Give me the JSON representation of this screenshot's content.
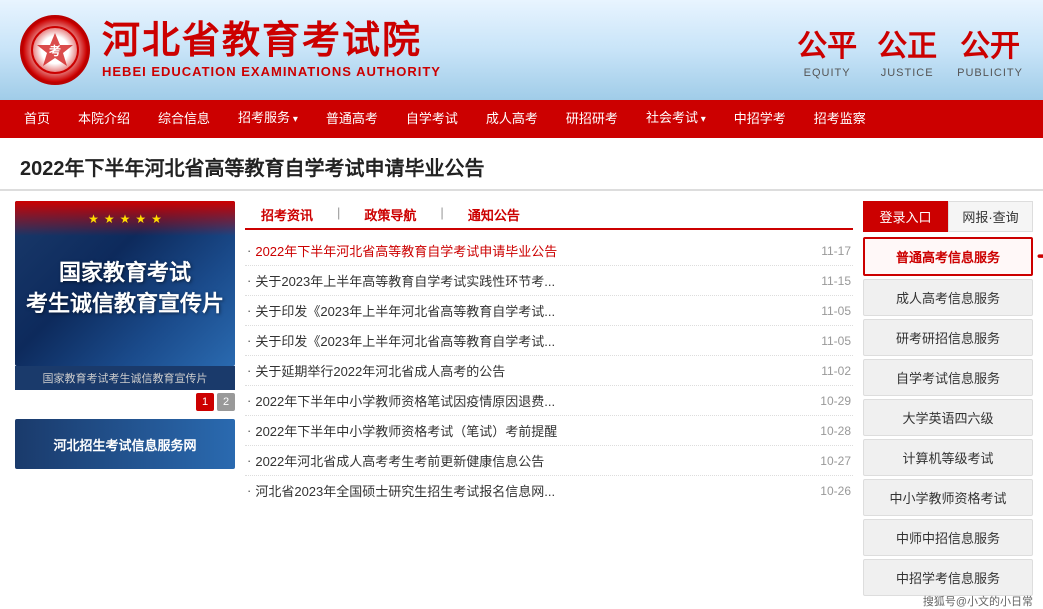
{
  "header": {
    "logo_main": "河北省教育考试院",
    "logo_sub": "HEBEI EDUCATION EXAMINATIONS AUTHORITY",
    "equity": [
      {
        "icon": "公平",
        "label": "EQUITY"
      },
      {
        "icon": "公正",
        "label": "JUSTICE"
      },
      {
        "icon": "公开",
        "label": "PUBLICITY"
      }
    ]
  },
  "nav": {
    "items": [
      {
        "label": "首页",
        "has_arrow": false
      },
      {
        "label": "本院介绍",
        "has_arrow": false
      },
      {
        "label": "综合信息",
        "has_arrow": false
      },
      {
        "label": "招考服务",
        "has_arrow": true
      },
      {
        "label": "普通高考",
        "has_arrow": false
      },
      {
        "label": "自学考试",
        "has_arrow": false
      },
      {
        "label": "成人高考",
        "has_arrow": false
      },
      {
        "label": "研招研考",
        "has_arrow": false
      },
      {
        "label": "社会考试",
        "has_arrow": true
      },
      {
        "label": "中招学考",
        "has_arrow": false
      },
      {
        "label": "招考监察",
        "has_arrow": false
      }
    ]
  },
  "page_title": "2022年下半年河北省高等教育自学考试申请毕业公告",
  "banner": {
    "stars": [
      "★",
      "★",
      "★",
      "★",
      "★"
    ],
    "line1": "国家教育考试",
    "line2": "考生诚信教育宣传片",
    "caption": "国家教育考试考生诚信教育宣传片",
    "pages": [
      "1",
      "2"
    ]
  },
  "bottom_banner": {
    "text": "河北招生考试信息服务网"
  },
  "news": {
    "tabs": [
      {
        "label": "招考资讯",
        "active": true
      },
      {
        "label": "政策导航"
      },
      {
        "label": "通知公告"
      }
    ],
    "items": [
      {
        "text": "·2022年下半年河北省高等教育自学考试申请毕业公告",
        "date": "11-17",
        "highlight": true
      },
      {
        "text": "·关于2023年上半年高等教育自学考试实践性环节考...",
        "date": "11-15",
        "highlight": false
      },
      {
        "text": "·关于印发《2023年上半年河北省高等教育自学考试...",
        "date": "11-05",
        "highlight": false
      },
      {
        "text": "·关于印发《2023年上半年河北省高等教育自学考试...",
        "date": "11-05",
        "highlight": false
      },
      {
        "text": "·关于延期举行2022年河北省成人高考的公告",
        "date": "11-02",
        "highlight": false
      },
      {
        "text": "·2022年下半年中小学教师资格笔试因疫情原因退费...",
        "date": "10-29",
        "highlight": false
      },
      {
        "text": "·2022年下半年中小学教师资格考试（笔试）考前提醒",
        "date": "10-28",
        "highlight": false
      },
      {
        "text": "·2022年河北省成人高考考生考前更新健康信息公告",
        "date": "10-27",
        "highlight": false
      },
      {
        "text": "·河北省2023年全国硕士研究生招生考试报名信息网...",
        "date": "10-26",
        "highlight": false
      }
    ]
  },
  "sidebar": {
    "tabs": [
      {
        "label": "登录入口",
        "active": true
      },
      {
        "label": "网报·查询",
        "active": false
      }
    ],
    "buttons": [
      {
        "label": "普通高考信息服务",
        "highlight": true
      },
      {
        "label": "成人高考信息服务",
        "highlight": false
      },
      {
        "label": "研考研招信息服务",
        "highlight": false
      },
      {
        "label": "自学考试信息服务",
        "highlight": false
      },
      {
        "label": "大学英语四六级",
        "highlight": false
      },
      {
        "label": "计算机等级考试",
        "highlight": false
      },
      {
        "label": "中小学教师资格考试",
        "highlight": false
      },
      {
        "label": "中师中招信息服务",
        "highlight": false
      },
      {
        "label": "中招学考信息服务",
        "highlight": false
      }
    ]
  },
  "watermark": "搜狐号@小文的小日常"
}
